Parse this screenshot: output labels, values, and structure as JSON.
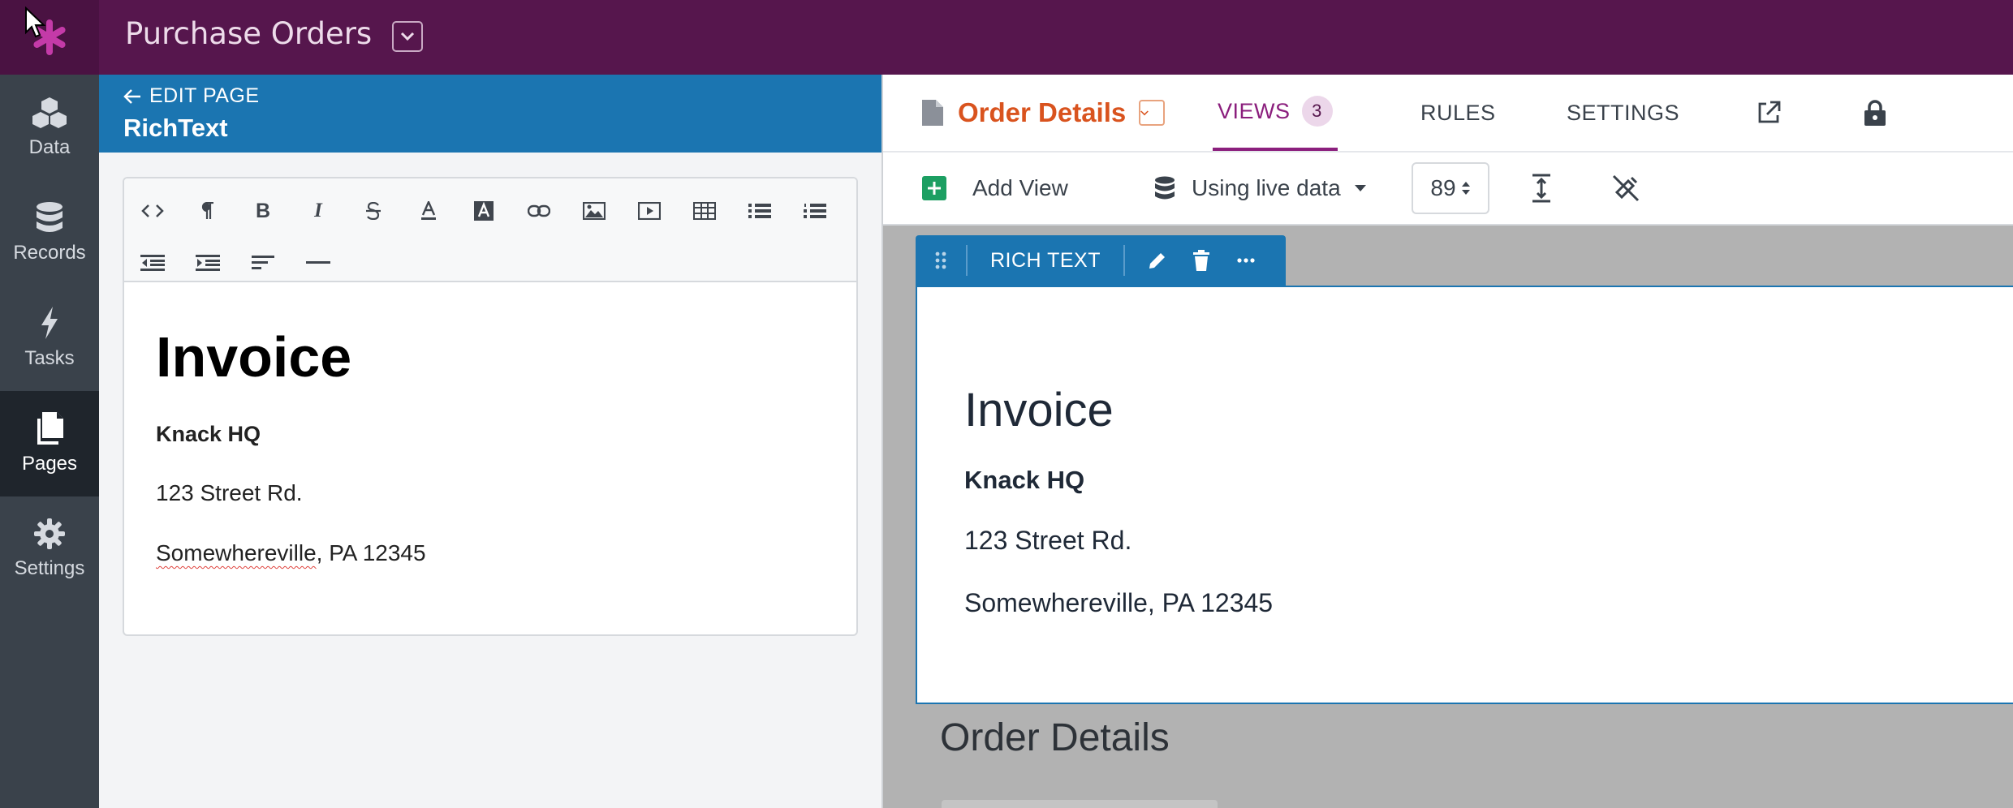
{
  "app": {
    "title": "Purchase Orders",
    "accent_color": "#56164d",
    "logo": "knack-asterisk-logo"
  },
  "leftnav": {
    "items": [
      {
        "label": "Data",
        "icon": "cubes-icon",
        "active": false
      },
      {
        "label": "Records",
        "icon": "database-icon",
        "active": false
      },
      {
        "label": "Tasks",
        "icon": "lightning-icon",
        "active": false
      },
      {
        "label": "Pages",
        "icon": "pages-icon",
        "active": true
      },
      {
        "label": "Settings",
        "icon": "gear-icon",
        "active": false
      }
    ]
  },
  "left_panel": {
    "back_label": "EDIT PAGE",
    "subtitle": "RichText",
    "toolbar": {
      "buttons": [
        "code-icon",
        "paragraph-icon",
        "bold-icon",
        "italic-icon",
        "strikethrough-icon",
        "font-color-icon",
        "background-color-icon",
        "link-icon",
        "image-icon",
        "video-icon",
        "table-icon",
        "unordered-list-icon",
        "ordered-list-icon",
        "outdent-icon",
        "indent-icon",
        "align-icon",
        "horizontal-rule-icon"
      ]
    },
    "editor": {
      "heading": "Invoice",
      "company": "Knack HQ",
      "line1": "123 Street Rd.",
      "line2_word": "Somewhereville",
      "line2_rest": ", PA 12345"
    }
  },
  "right_panel": {
    "page_name": "Order Details",
    "tabs": {
      "views_label": "VIEWS",
      "views_count": "3",
      "rules_label": "RULES",
      "settings_label": "SETTINGS"
    },
    "toolbar": {
      "add_view_label": "Add View",
      "data_mode_label": "Using live data",
      "zoom_value": "89"
    },
    "view": {
      "type_label": "RICH TEXT",
      "heading": "Invoice",
      "company": "Knack HQ",
      "line1": "123 Street Rd.",
      "line2": "Somewhereville, PA 12345"
    },
    "next_view_heading": "Order Details"
  }
}
